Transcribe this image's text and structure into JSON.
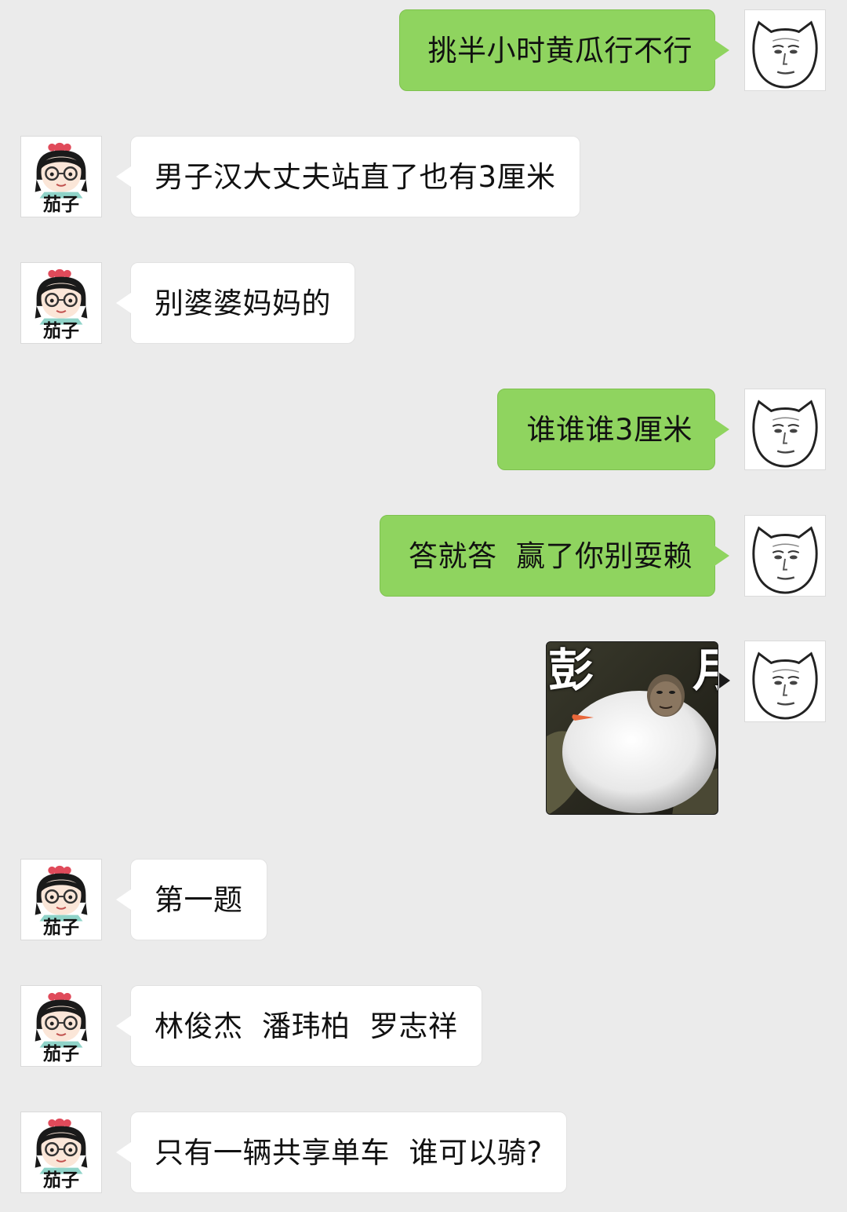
{
  "colors": {
    "background": "#ebebeb",
    "outgoing_bubble": "#8fd45f",
    "incoming_bubble": "#ffffff"
  },
  "contacts": {
    "other_name": "茄子",
    "self_avatar_icon": "cartoon-face-icon",
    "other_avatar_icon": "girl-cartoon-icon"
  },
  "messages": [
    {
      "sender": "self",
      "type": "text",
      "text": "挑半小时黄瓜行不行"
    },
    {
      "sender": "other",
      "type": "text",
      "text": "男子汉大丈夫站直了也有3厘米"
    },
    {
      "sender": "other",
      "type": "text",
      "text": "别婆婆妈妈的"
    },
    {
      "sender": "self",
      "type": "text",
      "text": "谁谁谁3厘米"
    },
    {
      "sender": "self",
      "type": "text",
      "text": "答就答  赢了你别耍赖"
    },
    {
      "sender": "self",
      "type": "sticker",
      "caption_left": "彭",
      "caption_right": "月"
    },
    {
      "sender": "other",
      "type": "text",
      "text": "第一题"
    },
    {
      "sender": "other",
      "type": "text",
      "text": "林俊杰  潘玮柏  罗志祥"
    },
    {
      "sender": "other",
      "type": "text",
      "text": "只有一辆共享单车  谁可以骑?"
    }
  ]
}
